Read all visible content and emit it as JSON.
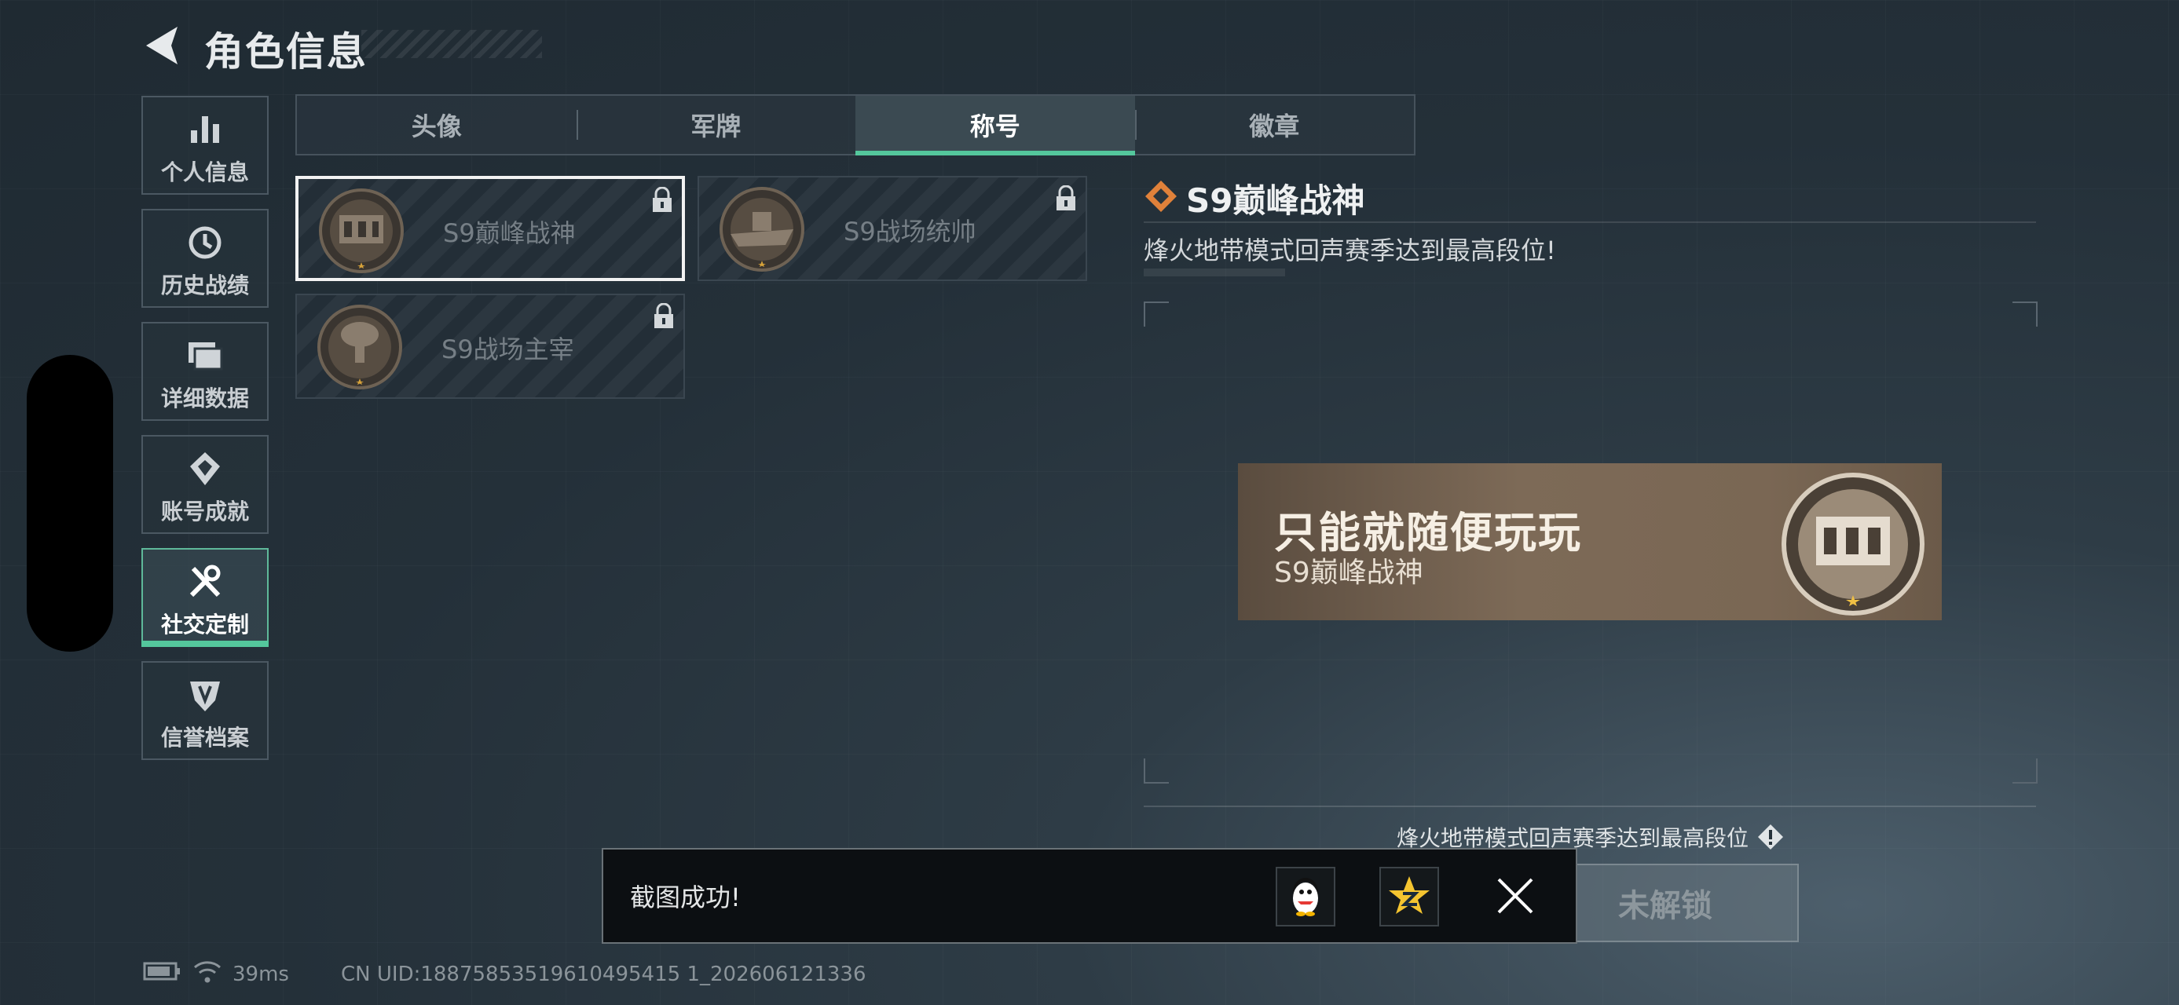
{
  "header": {
    "title": "角色信息"
  },
  "sidebar": {
    "items": [
      {
        "label": "个人信息",
        "icon": "bar-chart-icon"
      },
      {
        "label": "历史战绩",
        "icon": "clock-history-icon"
      },
      {
        "label": "详细数据",
        "icon": "folder-icon"
      },
      {
        "label": "账号成就",
        "icon": "achievement-icon"
      },
      {
        "label": "社交定制",
        "icon": "tools-icon"
      },
      {
        "label": "信誉档案",
        "icon": "credit-shield-icon"
      }
    ],
    "active_index": 4
  },
  "tabs": [
    {
      "label": "头像"
    },
    {
      "label": "军牌"
    },
    {
      "label": "称号"
    },
    {
      "label": "徽章"
    }
  ],
  "active_tab": 2,
  "titles": [
    {
      "name": "S9巅峰战神",
      "locked": true,
      "selected": true
    },
    {
      "name": "S9战场统帅",
      "locked": true,
      "selected": false
    },
    {
      "name": "S9战场主宰",
      "locked": true,
      "selected": false
    }
  ],
  "detail": {
    "title": "S9巅峰战神",
    "description": "烽火地带模式回声赛季达到最高段位!",
    "preview": {
      "player_name": "只能就随便玩玩",
      "title": "S9巅峰战神"
    },
    "condition": "烽火地带模式回声赛季达到最高段位",
    "button_label": "未解锁"
  },
  "toast": {
    "message": "截图成功!"
  },
  "status": {
    "ping": "39ms",
    "uid": "CN UID:18875853519610495415 1_202606121336"
  },
  "colors": {
    "accent": "#54c79c",
    "detail_icon": "#e0813a",
    "banner": "#7d6a57"
  }
}
